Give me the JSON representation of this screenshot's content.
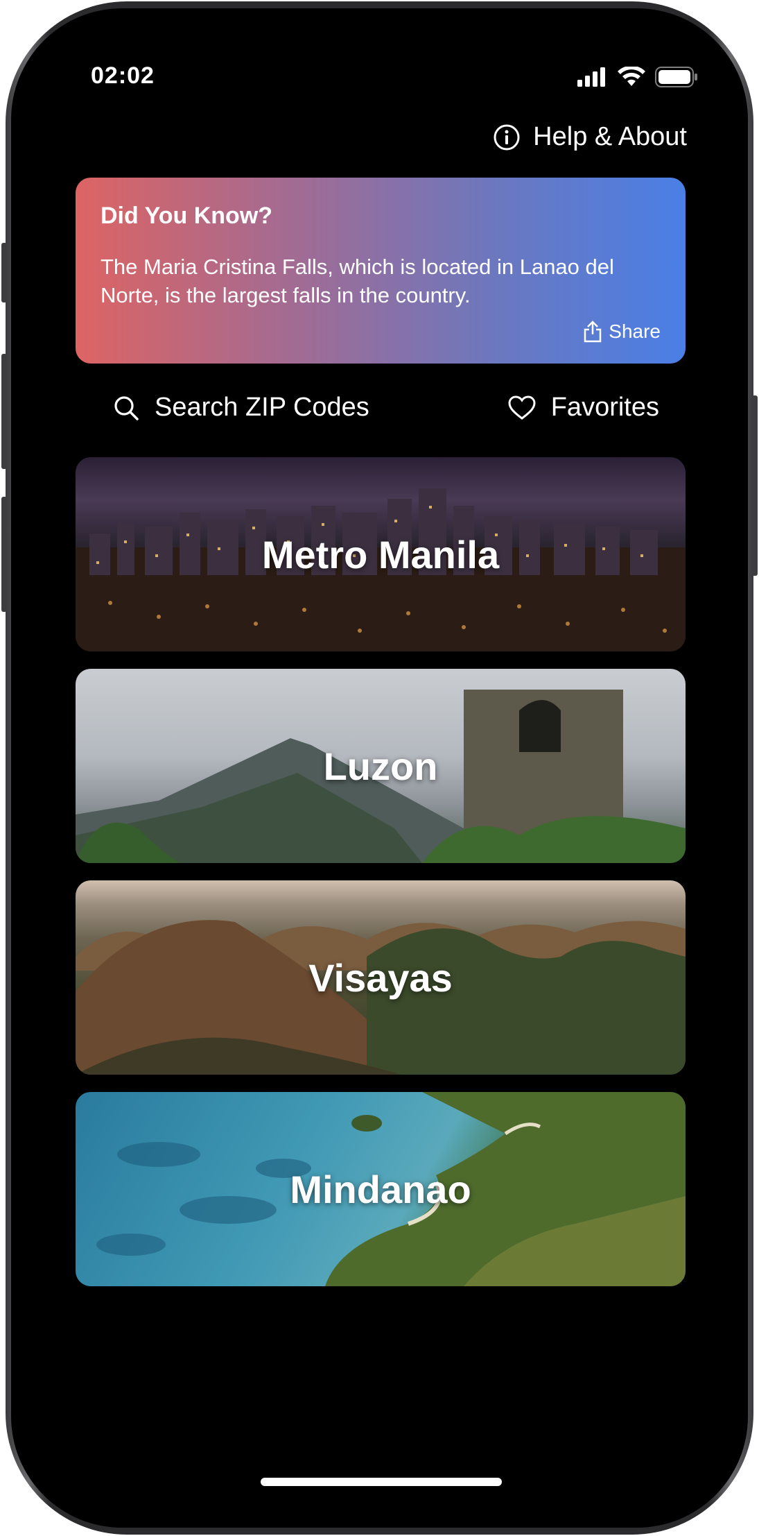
{
  "status_bar": {
    "time": "02:02"
  },
  "header": {
    "help_label": "Help & About"
  },
  "did_you_know": {
    "title": "Did You Know?",
    "body": "The Maria Cristina Falls, which is located in Lanao del Norte, is the largest falls in the country.",
    "share_label": "Share"
  },
  "toolbar": {
    "search_label": "Search ZIP Codes",
    "favorites_label": "Favorites"
  },
  "regions": [
    {
      "label": "Metro Manila"
    },
    {
      "label": "Luzon"
    },
    {
      "label": "Visayas"
    },
    {
      "label": "Mindanao"
    }
  ],
  "colors": {
    "background": "#000000",
    "banner_gradient_start": "#dd6463",
    "banner_gradient_end": "#4a7fe6",
    "text": "#ffffff"
  }
}
